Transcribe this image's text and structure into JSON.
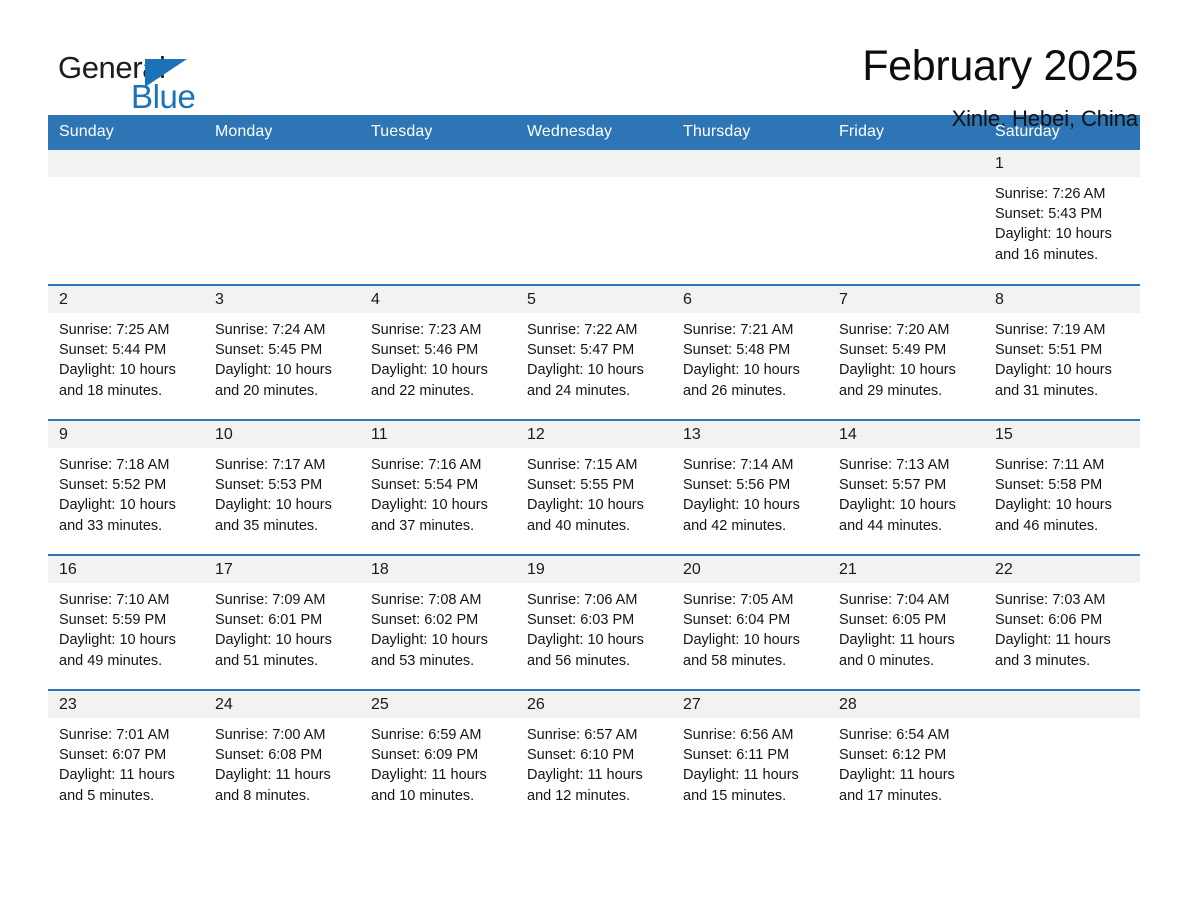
{
  "brand": {
    "name_part1": "General",
    "name_part2": "Blue",
    "accent_color": "#1b72b8"
  },
  "header": {
    "title": "February 2025",
    "location": "Xinle, Hebei, China"
  },
  "calendar": {
    "header_color": "#2e75b6",
    "daynum_band_color": "#f2f2f2",
    "weekday_headers": [
      "Sunday",
      "Monday",
      "Tuesday",
      "Wednesday",
      "Thursday",
      "Friday",
      "Saturday"
    ],
    "weeks": [
      [
        {
          "day": "",
          "sunrise": "",
          "sunset": "",
          "daylight": ""
        },
        {
          "day": "",
          "sunrise": "",
          "sunset": "",
          "daylight": ""
        },
        {
          "day": "",
          "sunrise": "",
          "sunset": "",
          "daylight": ""
        },
        {
          "day": "",
          "sunrise": "",
          "sunset": "",
          "daylight": ""
        },
        {
          "day": "",
          "sunrise": "",
          "sunset": "",
          "daylight": ""
        },
        {
          "day": "",
          "sunrise": "",
          "sunset": "",
          "daylight": ""
        },
        {
          "day": "1",
          "sunrise": "Sunrise: 7:26 AM",
          "sunset": "Sunset: 5:43 PM",
          "daylight": "Daylight: 10 hours and 16 minutes."
        }
      ],
      [
        {
          "day": "2",
          "sunrise": "Sunrise: 7:25 AM",
          "sunset": "Sunset: 5:44 PM",
          "daylight": "Daylight: 10 hours and 18 minutes."
        },
        {
          "day": "3",
          "sunrise": "Sunrise: 7:24 AM",
          "sunset": "Sunset: 5:45 PM",
          "daylight": "Daylight: 10 hours and 20 minutes."
        },
        {
          "day": "4",
          "sunrise": "Sunrise: 7:23 AM",
          "sunset": "Sunset: 5:46 PM",
          "daylight": "Daylight: 10 hours and 22 minutes."
        },
        {
          "day": "5",
          "sunrise": "Sunrise: 7:22 AM",
          "sunset": "Sunset: 5:47 PM",
          "daylight": "Daylight: 10 hours and 24 minutes."
        },
        {
          "day": "6",
          "sunrise": "Sunrise: 7:21 AM",
          "sunset": "Sunset: 5:48 PM",
          "daylight": "Daylight: 10 hours and 26 minutes."
        },
        {
          "day": "7",
          "sunrise": "Sunrise: 7:20 AM",
          "sunset": "Sunset: 5:49 PM",
          "daylight": "Daylight: 10 hours and 29 minutes."
        },
        {
          "day": "8",
          "sunrise": "Sunrise: 7:19 AM",
          "sunset": "Sunset: 5:51 PM",
          "daylight": "Daylight: 10 hours and 31 minutes."
        }
      ],
      [
        {
          "day": "9",
          "sunrise": "Sunrise: 7:18 AM",
          "sunset": "Sunset: 5:52 PM",
          "daylight": "Daylight: 10 hours and 33 minutes."
        },
        {
          "day": "10",
          "sunrise": "Sunrise: 7:17 AM",
          "sunset": "Sunset: 5:53 PM",
          "daylight": "Daylight: 10 hours and 35 minutes."
        },
        {
          "day": "11",
          "sunrise": "Sunrise: 7:16 AM",
          "sunset": "Sunset: 5:54 PM",
          "daylight": "Daylight: 10 hours and 37 minutes."
        },
        {
          "day": "12",
          "sunrise": "Sunrise: 7:15 AM",
          "sunset": "Sunset: 5:55 PM",
          "daylight": "Daylight: 10 hours and 40 minutes."
        },
        {
          "day": "13",
          "sunrise": "Sunrise: 7:14 AM",
          "sunset": "Sunset: 5:56 PM",
          "daylight": "Daylight: 10 hours and 42 minutes."
        },
        {
          "day": "14",
          "sunrise": "Sunrise: 7:13 AM",
          "sunset": "Sunset: 5:57 PM",
          "daylight": "Daylight: 10 hours and 44 minutes."
        },
        {
          "day": "15",
          "sunrise": "Sunrise: 7:11 AM",
          "sunset": "Sunset: 5:58 PM",
          "daylight": "Daylight: 10 hours and 46 minutes."
        }
      ],
      [
        {
          "day": "16",
          "sunrise": "Sunrise: 7:10 AM",
          "sunset": "Sunset: 5:59 PM",
          "daylight": "Daylight: 10 hours and 49 minutes."
        },
        {
          "day": "17",
          "sunrise": "Sunrise: 7:09 AM",
          "sunset": "Sunset: 6:01 PM",
          "daylight": "Daylight: 10 hours and 51 minutes."
        },
        {
          "day": "18",
          "sunrise": "Sunrise: 7:08 AM",
          "sunset": "Sunset: 6:02 PM",
          "daylight": "Daylight: 10 hours and 53 minutes."
        },
        {
          "day": "19",
          "sunrise": "Sunrise: 7:06 AM",
          "sunset": "Sunset: 6:03 PM",
          "daylight": "Daylight: 10 hours and 56 minutes."
        },
        {
          "day": "20",
          "sunrise": "Sunrise: 7:05 AM",
          "sunset": "Sunset: 6:04 PM",
          "daylight": "Daylight: 10 hours and 58 minutes."
        },
        {
          "day": "21",
          "sunrise": "Sunrise: 7:04 AM",
          "sunset": "Sunset: 6:05 PM",
          "daylight": "Daylight: 11 hours and 0 minutes."
        },
        {
          "day": "22",
          "sunrise": "Sunrise: 7:03 AM",
          "sunset": "Sunset: 6:06 PM",
          "daylight": "Daylight: 11 hours and 3 minutes."
        }
      ],
      [
        {
          "day": "23",
          "sunrise": "Sunrise: 7:01 AM",
          "sunset": "Sunset: 6:07 PM",
          "daylight": "Daylight: 11 hours and 5 minutes."
        },
        {
          "day": "24",
          "sunrise": "Sunrise: 7:00 AM",
          "sunset": "Sunset: 6:08 PM",
          "daylight": "Daylight: 11 hours and 8 minutes."
        },
        {
          "day": "25",
          "sunrise": "Sunrise: 6:59 AM",
          "sunset": "Sunset: 6:09 PM",
          "daylight": "Daylight: 11 hours and 10 minutes."
        },
        {
          "day": "26",
          "sunrise": "Sunrise: 6:57 AM",
          "sunset": "Sunset: 6:10 PM",
          "daylight": "Daylight: 11 hours and 12 minutes."
        },
        {
          "day": "27",
          "sunrise": "Sunrise: 6:56 AM",
          "sunset": "Sunset: 6:11 PM",
          "daylight": "Daylight: 11 hours and 15 minutes."
        },
        {
          "day": "28",
          "sunrise": "Sunrise: 6:54 AM",
          "sunset": "Sunset: 6:12 PM",
          "daylight": "Daylight: 11 hours and 17 minutes."
        },
        {
          "day": "",
          "sunrise": "",
          "sunset": "",
          "daylight": ""
        }
      ]
    ]
  }
}
